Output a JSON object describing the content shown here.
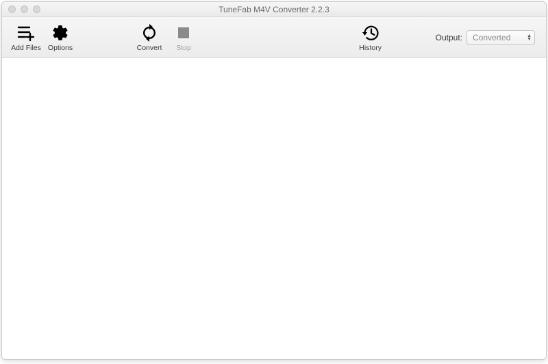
{
  "window": {
    "title": "TuneFab M4V Converter 2.2.3"
  },
  "toolbar": {
    "add_files_label": "Add Files",
    "options_label": "Options",
    "convert_label": "Convert",
    "stop_label": "Stop",
    "history_label": "History"
  },
  "output": {
    "label": "Output:",
    "selected": "Converted"
  }
}
